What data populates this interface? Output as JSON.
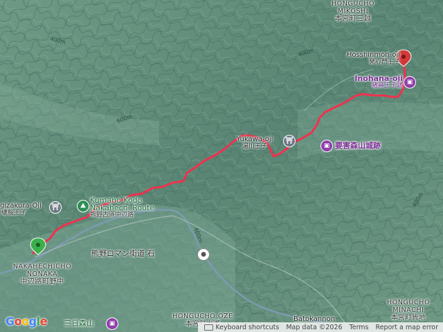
{
  "map": {
    "colors": {
      "route": "#f0314e",
      "water": "#7f9bb5",
      "poi_purple": "#8e3ea8",
      "poi_green": "#2f8f54",
      "terrain_dark": "#3d6659",
      "terrain_light": "#9cc0ad"
    },
    "labels": {
      "hongucho_mikoshi_en1": "HONGUCHO",
      "hongucho_mikoshi_en2": "MIKOSHI",
      "hongucho_mikoshi_ja": "本宮町三越",
      "hosshinmon_en": "Hosshinmon-oji",
      "hosshinmon_ja": "発心門王子",
      "inohana_en": "Inohana-oji",
      "inohana_ja": "猪鼻王子跡",
      "yukawa_en": "Yukawa-oji",
      "yukawa_ja": "湯川王子",
      "yogaimoriyama": "要害森山城跡",
      "kumano_kodo_1": "Kumano Kodo",
      "kumano_kodo_2": "Nakahechi Route",
      "kumano_kodo_ja": "熊野古道中辺路",
      "tsugizakura_en": "Tsugizakura-Oji",
      "tsugizakura_ja": "継桜王子",
      "nakahechicho_en1": "NAKAHECHICHO",
      "nakahechicho_en2": "NONAKA",
      "nakahechicho_ja": "中辺路町野中",
      "roman_kaido": "熊野ロマン街道 石",
      "hongucho_oze_en": "HONGUCHO OZE",
      "hongucho_oze_ja": "本宮町大瀬",
      "batokannon": "Batokannon",
      "hongucho_minachi_en1": "HONGUCHO",
      "hongucho_minachi_en2": "MINACHI",
      "hongucho_minachi_ja": "本宮町皆地",
      "mikkamoriyama": "三日森山",
      "contour_400": "400m",
      "contour_600": "600m"
    },
    "icons": {
      "temple": "torii-icon",
      "landmark": "landmark-icon",
      "start": "start-marker-icon",
      "end": "end-marker-icon"
    }
  },
  "footer": {
    "google": "Google",
    "keyboard_shortcuts": "Keyboard shortcuts",
    "map_data": "Map data ©2026",
    "terms": "Terms",
    "report": "Report a map error"
  }
}
